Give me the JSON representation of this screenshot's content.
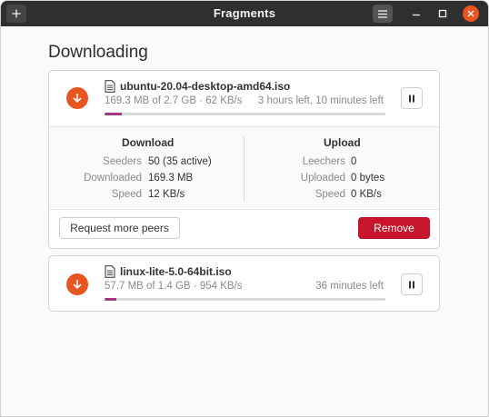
{
  "window": {
    "title": "Fragments",
    "add_icon": "plus-icon",
    "menu_icon": "hamburger-menu-icon",
    "accent": "#e95420"
  },
  "section": {
    "title": "Downloading"
  },
  "torrents": [
    {
      "name": "ubuntu-20.04-desktop-amd64.iso",
      "meta": "169.3 MB of 2.7 GB · 62 KB/s",
      "eta": "3 hours left, 10 minutes left",
      "progress": 0.063,
      "expanded": true,
      "details": {
        "download": {
          "title": "Download",
          "stats": [
            {
              "label": "Seeders",
              "value": "50 (35 active)"
            },
            {
              "label": "Downloaded",
              "value": "169.3 MB"
            },
            {
              "label": "Speed",
              "value": "12 KB/s"
            }
          ]
        },
        "upload": {
          "title": "Upload",
          "stats": [
            {
              "label": "Leechers",
              "value": "0"
            },
            {
              "label": "Uploaded",
              "value": "0 bytes"
            },
            {
              "label": "Speed",
              "value": "0 KB/s"
            }
          ]
        }
      },
      "actions": {
        "request_peers": "Request more peers",
        "remove": "Remove",
        "remove_color": "#c7162b"
      }
    },
    {
      "name": "linux-lite-5.0-64bit.iso",
      "meta": "57.7 MB of 1.4 GB · 954 KB/s",
      "eta": "36 minutes left",
      "progress": 0.042,
      "expanded": false
    }
  ]
}
